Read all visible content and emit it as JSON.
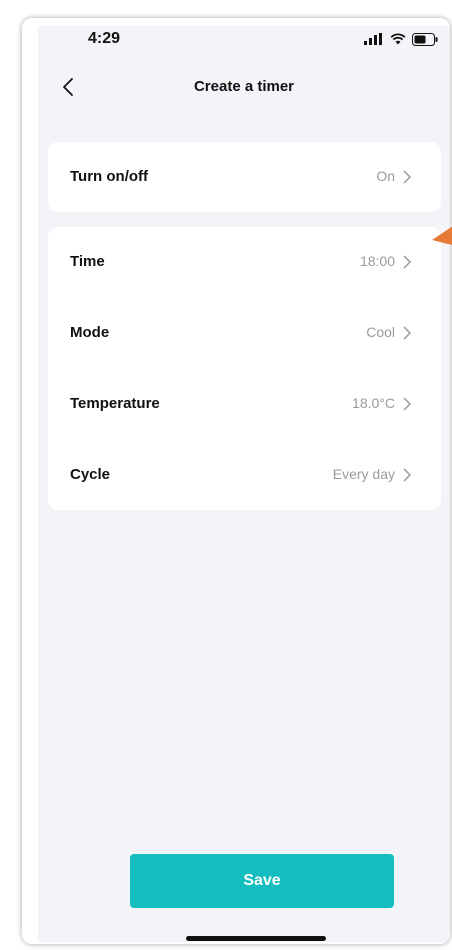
{
  "status_bar": {
    "time": "4:29"
  },
  "nav": {
    "title": "Create a timer"
  },
  "card_power": {
    "rows": [
      {
        "label": "Turn on/off",
        "value": "On"
      }
    ]
  },
  "card_settings": {
    "rows": [
      {
        "label": "Time",
        "value": "18:00"
      },
      {
        "label": "Mode",
        "value": "Cool"
      },
      {
        "label": "Temperature",
        "value": "18.0°C"
      },
      {
        "label": "Cycle",
        "value": "Every day"
      }
    ]
  },
  "actions": {
    "save_label": "Save"
  },
  "colors": {
    "accent": "#14bdbf",
    "annotation_arrow": "#e87a36",
    "background": "#f2f4f8"
  },
  "icons": [
    "back-chevron-icon",
    "signal-icon",
    "wifi-icon",
    "battery-icon",
    "chevron-right-icon"
  ]
}
